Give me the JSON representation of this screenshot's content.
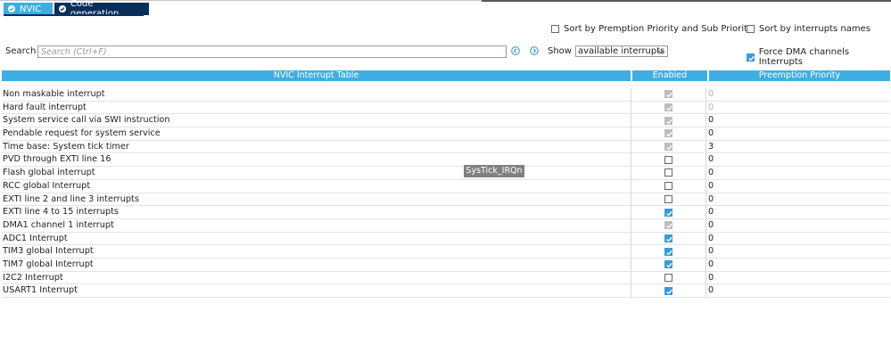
{
  "tabs": [
    {
      "label": "NVIC",
      "icon": "check-circle-icon"
    },
    {
      "label": "Code generation",
      "icon": "check-circle-icon"
    }
  ],
  "options": {
    "sort_premption": {
      "label": "Sort by Premption Priority and Sub Priority",
      "checked": false
    },
    "sort_names": {
      "label": "Sort by interrupts names",
      "checked": false
    },
    "force_dma": {
      "label": "Force DMA channels Interrupts",
      "checked": true
    }
  },
  "search": {
    "label": "Search",
    "placeholder": "Search (Ctrl+F)",
    "value": ""
  },
  "show": {
    "label": "Show",
    "selected": "available interrupts"
  },
  "table": {
    "headers": [
      "NVIC Interrupt Table",
      "Enabled",
      "Preemption Priority"
    ],
    "rows": [
      {
        "name": "Non maskable interrupt",
        "enabled": true,
        "locked": true,
        "priority": "0",
        "priority_dim": true
      },
      {
        "name": "Hard fault interrupt",
        "enabled": true,
        "locked": true,
        "priority": "0",
        "priority_dim": true
      },
      {
        "name": "System service call via SWI instruction",
        "enabled": true,
        "locked": true,
        "priority": "0",
        "priority_dim": false
      },
      {
        "name": "Pendable request for system service",
        "enabled": true,
        "locked": true,
        "priority": "0",
        "priority_dim": false
      },
      {
        "name": "Time base: System tick timer",
        "enabled": true,
        "locked": true,
        "priority": "3",
        "priority_dim": false
      },
      {
        "name": "PVD through EXTI line 16",
        "enabled": false,
        "locked": false,
        "priority": "0",
        "priority_dim": false
      },
      {
        "name": "Flash global interrupt",
        "enabled": false,
        "locked": false,
        "priority": "0",
        "priority_dim": false
      },
      {
        "name": "RCC global Interrupt",
        "enabled": false,
        "locked": false,
        "priority": "0",
        "priority_dim": false
      },
      {
        "name": "EXTI line 2 and line 3 interrupts",
        "enabled": false,
        "locked": false,
        "priority": "0",
        "priority_dim": false
      },
      {
        "name": "EXTI line 4 to 15 interrupts",
        "enabled": true,
        "locked": false,
        "priority": "0",
        "priority_dim": false
      },
      {
        "name": "DMA1 channel 1 interrupt",
        "enabled": true,
        "locked": true,
        "priority": "0",
        "priority_dim": false
      },
      {
        "name": "ADC1 Interrupt",
        "enabled": true,
        "locked": false,
        "priority": "0",
        "priority_dim": false
      },
      {
        "name": "TIM3 global Interrupt",
        "enabled": true,
        "locked": false,
        "priority": "0",
        "priority_dim": false
      },
      {
        "name": "TIM7 global Interrupt",
        "enabled": true,
        "locked": false,
        "priority": "0",
        "priority_dim": false
      },
      {
        "name": "I2C2 Interrupt",
        "enabled": false,
        "locked": false,
        "priority": "0",
        "priority_dim": false
      },
      {
        "name": "USART1 Interrupt",
        "enabled": true,
        "locked": false,
        "priority": "0",
        "priority_dim": false
      }
    ]
  },
  "tooltip": {
    "text": "SysTick_IRQn"
  },
  "colors": {
    "accent": "#3eaee2",
    "tab_dark": "#0b2f5a",
    "checkbox_blue": "#3c9ad9",
    "checkbox_locked": "#bdbdbd"
  }
}
